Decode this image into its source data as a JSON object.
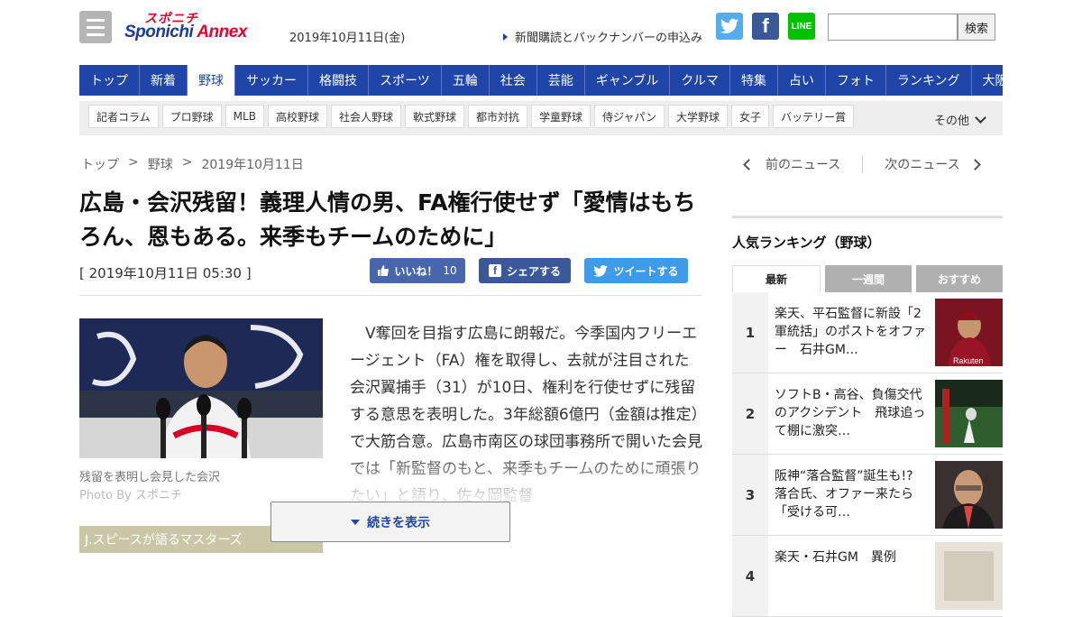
{
  "header": {
    "logo_top": "スポニチ",
    "logo_main": "Sponichi",
    "logo_annex": "Annex",
    "date": "2019年10月11日(金)",
    "subscribe_link": "新聞購読とバックナンバーの申込み",
    "sns": {
      "twitter": "twitter-icon",
      "facebook": "f",
      "line": "LINE"
    },
    "search_button": "検索",
    "search_value": ""
  },
  "nav": [
    "トップ",
    "新着",
    "野球",
    "サッカー",
    "格闘技",
    "スポーツ",
    "五輪",
    "社会",
    "芸能",
    "ギャンブル",
    "クルマ",
    "特集",
    "占い",
    "フォト",
    "ランキング",
    "大阪"
  ],
  "nav_active": "野球",
  "subnav": [
    "記者コラム",
    "プロ野球",
    "MLB",
    "高校野球",
    "社会人野球",
    "軟式野球",
    "都市対抗",
    "学童野球",
    "侍ジャパン",
    "大学野球",
    "女子",
    "バッテリー賞"
  ],
  "subnav_more": "その他",
  "breadcrumb": [
    "トップ",
    ">",
    "野球",
    ">",
    "2019年10月11日"
  ],
  "article": {
    "headline": "広島・会沢残留！義理人情の男、FA権行使せず「愛情はもちろん、恩もある。来季もチームのために」",
    "timestamp": "[ 2019年10月11日 05:30 ]",
    "like_label": "いいね！",
    "like_count": "10",
    "share_label": "シェアする",
    "tweet_label": "ツイートする",
    "photo_caption": "残留を表明し会見した会沢",
    "photo_by": "Photo By スポニチ",
    "promo_text": "J.スピースが語るマスターズ",
    "body": "V奪回を目指す広島に朗報だ。今季国内フリーエージェント（FA）権を取得し、去就が注目された会沢翼捕手（31）が10日、権利を行使せずに残留する意思を表明した。3年総額6億円（金額は推定）で大筋合意。広島市南区の球団事務所で開いた会見では「新監督のもと、来季もチームのために頑張りたい」と語り、佐々岡監督",
    "more_button": "続きを表示"
  },
  "sidebar": {
    "prev": "前のニュース",
    "next": "次のニュース",
    "ranking_title": "人気ランキング（野球）",
    "tabs": [
      "最新",
      "一週間",
      "おすすめ"
    ],
    "active_tab": "最新",
    "items": [
      {
        "rank": "1",
        "text": "楽天、平石監督に新設「2軍統括」のポストをオファー　石井GM…"
      },
      {
        "rank": "2",
        "text": "ソフトB・高谷、負傷交代のアクシデント　飛球追って棚に激突…"
      },
      {
        "rank": "3",
        "text": "阪神“落合監督”誕生も!?　落合氏、オファー来たら「受ける可…"
      },
      {
        "rank": "4",
        "text": "楽天・石井GM　異例"
      }
    ]
  },
  "colors": {
    "nav": "#1f45a8",
    "brand_red": "#e6002d",
    "twitter": "#55acee",
    "facebook": "#3b5998",
    "line": "#00c300"
  }
}
